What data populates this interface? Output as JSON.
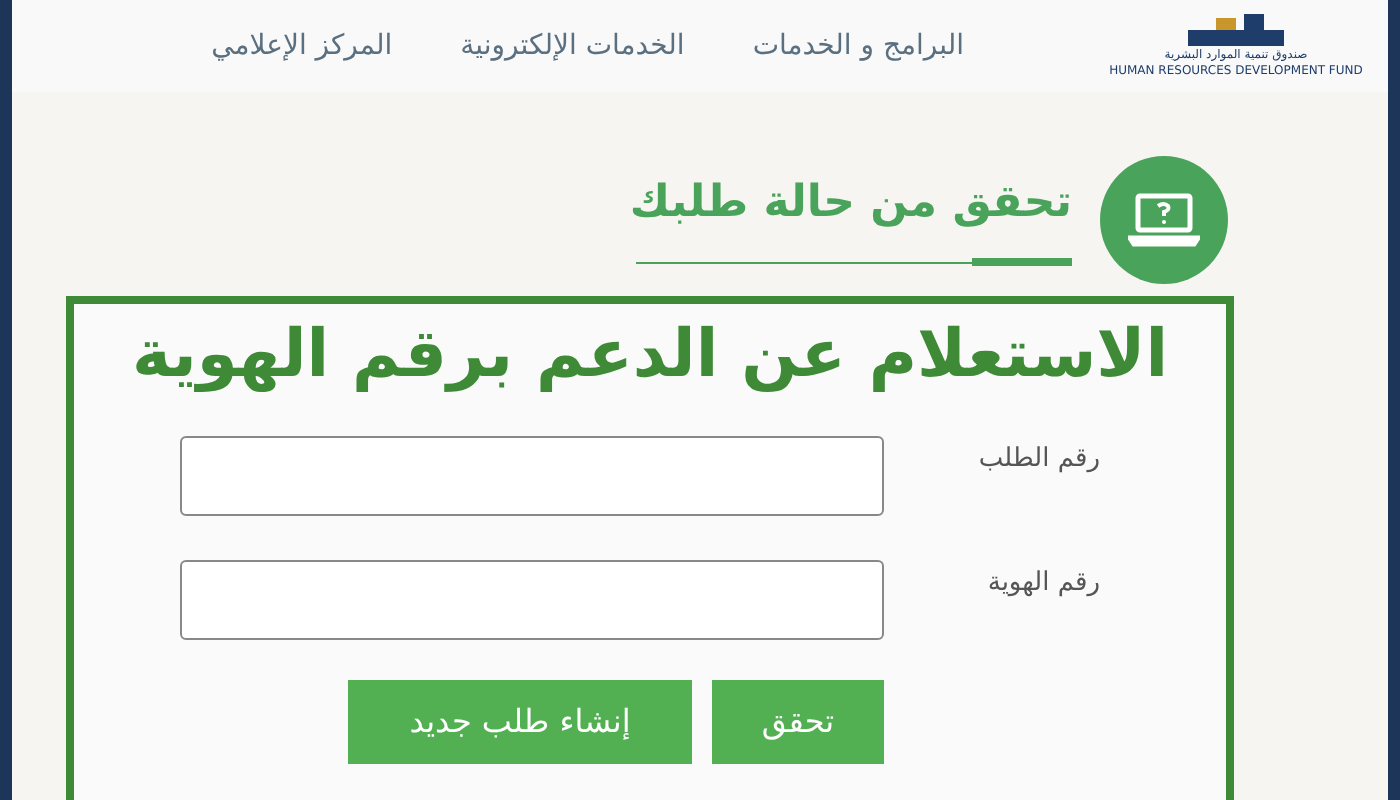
{
  "header": {
    "logo": {
      "caption": "صندوق تنمية الموارد البشرية",
      "subcaption": "HUMAN RESOURCES DEVELOPMENT FUND"
    },
    "nav": [
      {
        "label": "البرامج و الخدمات"
      },
      {
        "label": "الخدمات الإلكترونية"
      },
      {
        "label": "المركز الإعلامي"
      }
    ]
  },
  "section": {
    "title": "تحقق من حالة طلبك"
  },
  "form": {
    "banner": "الاستعلام عن الدعم برقم الهوية",
    "fields": [
      {
        "label": "رقم الطلب"
      },
      {
        "label": "رقم الهوية"
      }
    ],
    "buttons": [
      {
        "label": "تحقق"
      },
      {
        "label": "إنشاء طلب جديد"
      }
    ]
  }
}
